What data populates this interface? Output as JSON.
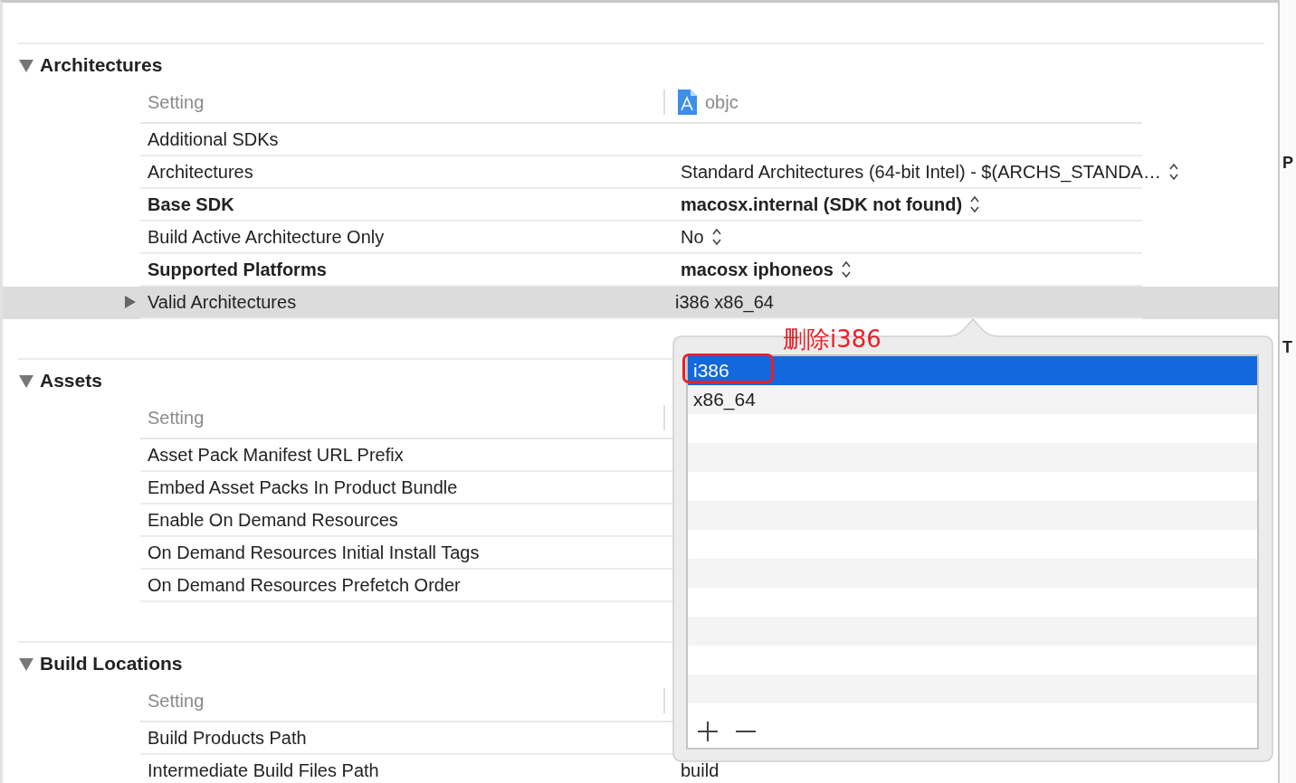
{
  "sections": [
    {
      "title": "Architectures",
      "expanded": true,
      "header": {
        "label": "Setting",
        "target": "objc"
      },
      "rows": [
        {
          "name": "Additional SDKs",
          "customized": false,
          "selected": false
        },
        {
          "name": "Architectures",
          "customized": false,
          "value": "Standard Architectures (64-bit Intel)  -  $(ARCHS_STANDA…",
          "popup": true,
          "selected": false
        },
        {
          "name": "Base SDK",
          "customized": true,
          "value": "macosx.internal (SDK not found)",
          "popup": true,
          "selected": false
        },
        {
          "name": "Build Active Architecture Only",
          "customized": false,
          "value": "No",
          "popup": true,
          "selected": false
        },
        {
          "name": "Supported Platforms",
          "customized": true,
          "value": "macosx iphoneos",
          "popup": true,
          "selected": false
        },
        {
          "name": "Valid Architectures",
          "customized": false,
          "value": "i386 x86_64",
          "expanded": false,
          "selected": true
        }
      ]
    },
    {
      "title": "Assets",
      "expanded": true,
      "header": {
        "label": "Setting"
      },
      "rows": [
        {
          "name": "Asset Pack Manifest URL Prefix",
          "customized": false,
          "selected": false
        },
        {
          "name": "Embed Asset Packs In Product Bundle",
          "customized": false,
          "selected": false
        },
        {
          "name": "Enable On Demand Resources",
          "customized": false,
          "selected": false
        },
        {
          "name": "On Demand Resources Initial Install Tags",
          "customized": false,
          "selected": false
        },
        {
          "name": "On Demand Resources Prefetch Order",
          "customized": false,
          "selected": false
        }
      ]
    },
    {
      "title": "Build Locations",
      "expanded": true,
      "header": {
        "label": "Setting"
      },
      "rows": [
        {
          "name": "Build Products Path",
          "customized": false,
          "selected": false
        },
        {
          "name": "Intermediate Build Files Path",
          "customized": false,
          "value": "build",
          "selected": false
        }
      ]
    }
  ],
  "popover": {
    "annotation": "删除i386",
    "items": [
      {
        "label": "i386",
        "selected": true
      },
      {
        "label": "x86_64",
        "selected": false
      }
    ]
  },
  "inspector_fragments": [
    "P",
    "T"
  ]
}
